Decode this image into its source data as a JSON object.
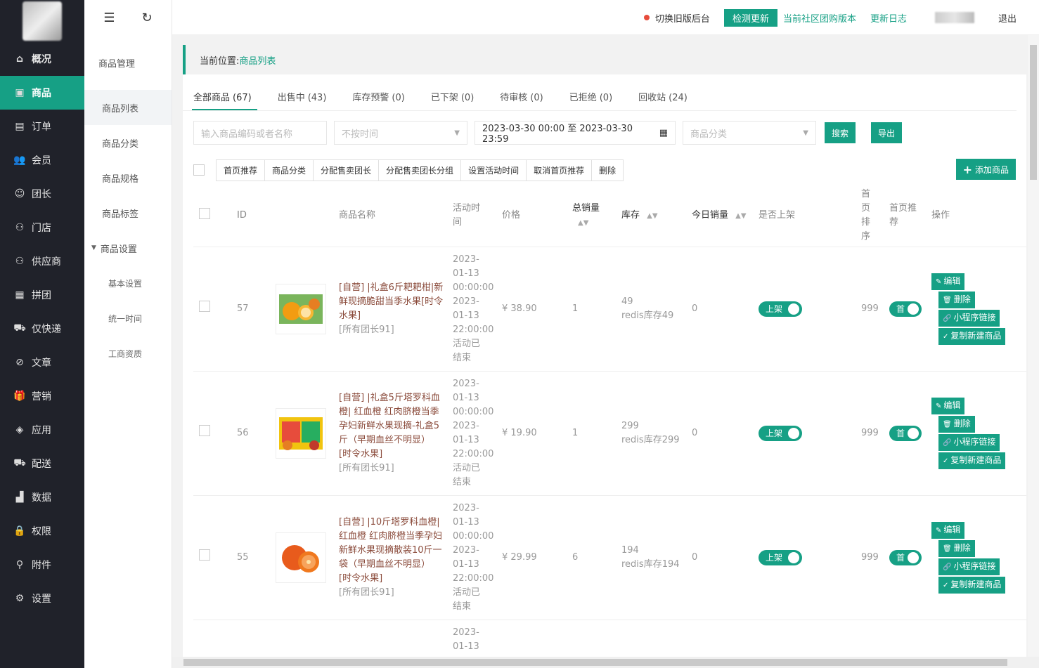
{
  "sidebar": {
    "items": [
      {
        "label": "概况",
        "icon": "home-icon",
        "glyph": "⌂"
      },
      {
        "label": "商品",
        "icon": "goods-icon",
        "glyph": "▣"
      },
      {
        "label": "订单",
        "icon": "order-icon",
        "glyph": "▤"
      },
      {
        "label": "会员",
        "icon": "member-icon",
        "glyph": "👥"
      },
      {
        "label": "团长",
        "icon": "leader-icon",
        "glyph": "☺"
      },
      {
        "label": "门店",
        "icon": "store-icon",
        "glyph": "⚇"
      },
      {
        "label": "供应商",
        "icon": "supplier-icon",
        "glyph": "⚇"
      },
      {
        "label": "拼团",
        "icon": "group-icon",
        "glyph": "▦"
      },
      {
        "label": "仅快递",
        "icon": "express-icon",
        "glyph": "⛟"
      },
      {
        "label": "文章",
        "icon": "article-icon",
        "glyph": "⊘"
      },
      {
        "label": "营销",
        "icon": "marketing-icon",
        "glyph": "🎁"
      },
      {
        "label": "应用",
        "icon": "app-icon",
        "glyph": "◈"
      },
      {
        "label": "配送",
        "icon": "delivery-icon",
        "glyph": "⛟"
      },
      {
        "label": "数据",
        "icon": "data-icon",
        "glyph": "▟"
      },
      {
        "label": "权限",
        "icon": "lock-icon",
        "glyph": "🔒"
      },
      {
        "label": "附件",
        "icon": "attachment-icon",
        "glyph": "⚲"
      },
      {
        "label": "设置",
        "icon": "gear-icon",
        "glyph": "⚙"
      }
    ]
  },
  "subside": {
    "title": "商品管理",
    "items": [
      "商品列表",
      "商品分类",
      "商品规格",
      "商品标签"
    ],
    "group": "商品设置",
    "sub_items": [
      "基本设置",
      "统一时间",
      "工商资质"
    ]
  },
  "topbar": {
    "switch_old": "切换旧版后台",
    "check_update": "检测更新",
    "version": "当前社区团购版本",
    "changelog": "更新日志",
    "logout": "退出"
  },
  "breadcrumb": {
    "label": "当前位置:",
    "current": "商品列表"
  },
  "tabs": [
    {
      "label": "全部商品",
      "count": "(67)"
    },
    {
      "label": "出售中",
      "count": "(43)"
    },
    {
      "label": "库存预警",
      "count": "(0)"
    },
    {
      "label": "已下架",
      "count": "(0)"
    },
    {
      "label": "待审核",
      "count": "(0)"
    },
    {
      "label": "已拒绝",
      "count": "(0)"
    },
    {
      "label": "回收站",
      "count": "(24)"
    }
  ],
  "filters": {
    "keyword_placeholder": "输入商品编码或者名称",
    "time_placeholder": "不按时间",
    "date_range": "2023-03-30 00:00 至 2023-03-30 23:59",
    "category_placeholder": "商品分类",
    "search": "搜索",
    "export": "导出"
  },
  "batch": [
    "首页推荐",
    "商品分类",
    "分配售卖团长",
    "分配售卖团长分组",
    "设置活动时间",
    "取消首页推荐",
    "删除"
  ],
  "add_button": "添加商品",
  "table": {
    "headers": {
      "id": "ID",
      "name": "商品名称",
      "activity": [
        "活动时",
        "间"
      ],
      "price": "价格",
      "sales": "总销量",
      "stock": "库存",
      "today": "今日销量",
      "onsale": "是否上架",
      "sort": [
        "首",
        "页",
        "排",
        "序"
      ],
      "recommend": [
        "首页推",
        "荐"
      ],
      "ops": "操作"
    },
    "rows": [
      {
        "id": "57",
        "name": "[自营] |礼盒6斤耙耙柑|新鲜现摘脆甜当季水果[时令水果]",
        "owner": "[所有团长91]",
        "activity": [
          "2023-",
          "01-13",
          "00:00:00",
          "2023-",
          "01-13",
          "22:00:00",
          "活动已",
          "结束"
        ],
        "price": "¥ 38.90",
        "sales": "1",
        "stock": "49",
        "stock_redis": "redis库存49",
        "today": "0",
        "onsale": "上架",
        "sort": "999",
        "recommend": "首"
      },
      {
        "id": "56",
        "name": "[自营] |礼盒5斤塔罗科血橙| 红血橙 红肉脐橙当季孕妇新鲜水果现摘-礼盒5斤（早期血丝不明显） [时令水果]",
        "owner": "[所有团长91]",
        "activity": [
          "2023-",
          "01-13",
          "00:00:00",
          "2023-",
          "01-13",
          "22:00:00",
          "活动已",
          "结束"
        ],
        "price": "¥ 19.90",
        "sales": "1",
        "stock": "299",
        "stock_redis": "redis库存299",
        "today": "0",
        "onsale": "上架",
        "sort": "999",
        "recommend": "首"
      },
      {
        "id": "55",
        "name": "[自营] |10斤塔罗科血橙| 红血橙 红肉脐橙当季孕妇新鲜水果现摘散装10斤一袋（早期血丝不明显） [时令水果]",
        "owner": "[所有团长91]",
        "activity": [
          "2023-",
          "01-13",
          "00:00:00",
          "2023-",
          "01-13",
          "22:00:00",
          "活动已",
          "结束"
        ],
        "price": "¥ 29.99",
        "sales": "6",
        "stock": "194",
        "stock_redis": "redis库存194",
        "today": "0",
        "onsale": "上架",
        "sort": "999",
        "recommend": "首"
      }
    ],
    "partial_row": [
      "2023-",
      "01-13"
    ],
    "ops": [
      "编辑",
      "删除",
      "小程序链接",
      "复制新建商品"
    ]
  }
}
